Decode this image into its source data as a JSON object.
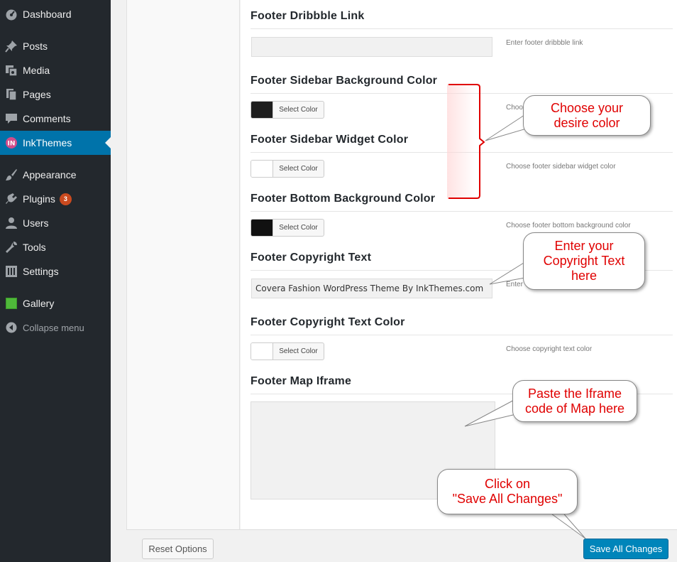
{
  "sidebar": {
    "items": [
      {
        "label": "Dashboard",
        "icon": "dashboard-icon"
      },
      {
        "label": "Posts",
        "icon": "pin-icon"
      },
      {
        "label": "Media",
        "icon": "media-icon"
      },
      {
        "label": "Pages",
        "icon": "pages-icon"
      },
      {
        "label": "Comments",
        "icon": "comments-icon"
      },
      {
        "label": "InkThemes",
        "icon": "inkthemes-icon",
        "active": true
      },
      {
        "label": "Appearance",
        "icon": "brush-icon"
      },
      {
        "label": "Plugins",
        "icon": "plugin-icon",
        "badge": "3"
      },
      {
        "label": "Users",
        "icon": "user-icon"
      },
      {
        "label": "Tools",
        "icon": "wrench-icon"
      },
      {
        "label": "Settings",
        "icon": "settings-icon"
      },
      {
        "label": "Gallery",
        "icon": "gallery-icon"
      }
    ],
    "collapse_label": "Collapse menu"
  },
  "options": {
    "dribbble": {
      "title": "Footer Dribbble Link",
      "value": "",
      "help": "Enter footer dribbble link"
    },
    "sidebar_bg": {
      "title": "Footer Sidebar Background Color",
      "button": "Select Color",
      "swatch": "#1e1e1e",
      "help": "Choose footer sidebar background color"
    },
    "widget_color": {
      "title": "Footer Sidebar Widget Color",
      "button": "Select Color",
      "swatch": "#ffffff",
      "help": "Choose footer sidebar widget color"
    },
    "bottom_bg": {
      "title": "Footer Bottom Background Color",
      "button": "Select Color",
      "swatch": "#111111",
      "help": "Choose footer bottom background color"
    },
    "copyright": {
      "title": "Footer Copyright Text",
      "value": "Covera Fashion WordPress Theme By InkThemes.com",
      "help": "Enter footer copyright text"
    },
    "copyright_color": {
      "title": "Footer Copyright Text Color",
      "button": "Select Color",
      "swatch": "#ffffff",
      "help": "Choose copyright text color"
    },
    "map": {
      "title": "Footer Map Iframe",
      "value": ""
    }
  },
  "footer": {
    "reset_label": "Reset Options",
    "save_label": "Save All Changes"
  },
  "callouts": {
    "color": [
      "Choose your",
      "desire color"
    ],
    "copyright": [
      "Enter your",
      "Copyright Text",
      "here"
    ],
    "map": [
      "Paste the Iframe",
      "code of Map here"
    ],
    "save": [
      "Click on",
      "\"Save All Changes\""
    ]
  },
  "colors": {
    "accent": "#0073aa",
    "sidebar_bg": "#23282d",
    "annotation": "#e00000",
    "badge": "#ca4a1f"
  }
}
